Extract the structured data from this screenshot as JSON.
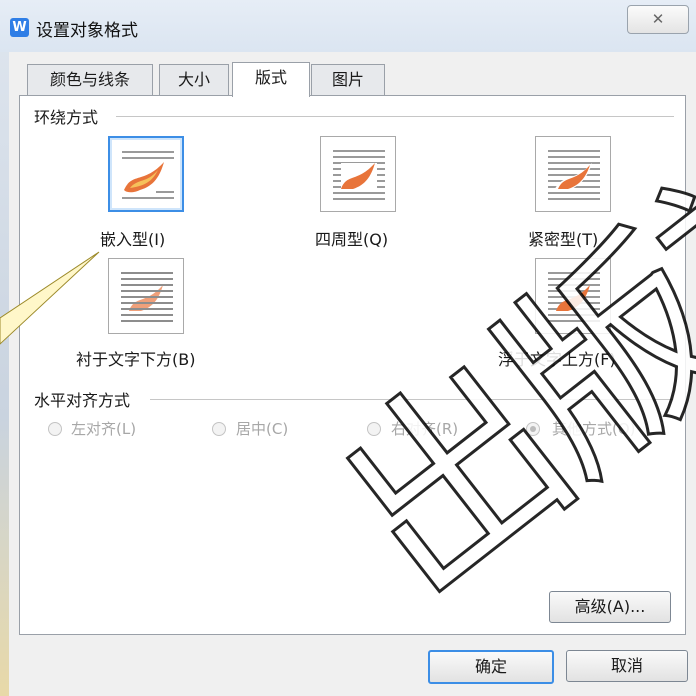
{
  "window": {
    "title": "设置对象格式",
    "close_glyph": "✕",
    "app_icon_letter": "W"
  },
  "tabs": [
    {
      "label": "颜色与线条"
    },
    {
      "label": "大小"
    },
    {
      "label": "版式",
      "active": true
    },
    {
      "label": "图片"
    }
  ],
  "wrap_section": {
    "title": "环绕方式",
    "options": [
      {
        "label": "嵌入型(I)",
        "selected": true
      },
      {
        "label": "四周型(Q)"
      },
      {
        "label": "紧密型(T)"
      },
      {
        "label": "衬于文字下方(B)"
      },
      {
        "label": "浮于文字上方(F)"
      }
    ]
  },
  "align_section": {
    "title": "水平对齐方式",
    "options": [
      {
        "label": "左对齐(L)"
      },
      {
        "label": "居中(C)"
      },
      {
        "label": "右对齐(R)"
      },
      {
        "label": "其他方式(O)",
        "selected": true
      }
    ]
  },
  "buttons": {
    "advanced": "高级(A)...",
    "ok": "确定",
    "cancel": "取消"
  },
  "watermark": "出版社",
  "colors": {
    "accent": "#3c8ee6",
    "titlebar": "#dbe5f1",
    "flame": "#e8743a"
  }
}
